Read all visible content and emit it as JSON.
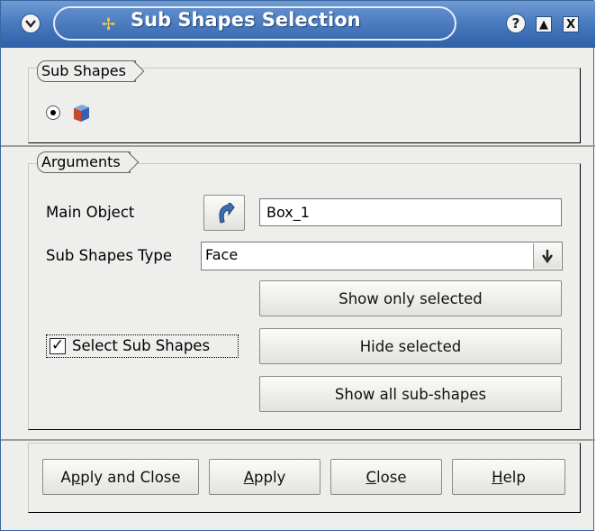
{
  "window": {
    "title": "Sub Shapes Selection",
    "title_color": "#ffffff",
    "titlebar_color": "#4a7cc0",
    "menu_icon": "chevron-down-icon",
    "logo_icon": "salome-logo-icon",
    "help_icon": "help-icon",
    "help_glyph": "?",
    "maximize_icon": "maximize-icon",
    "maximize_glyph": "▲",
    "close_icon": "close-icon",
    "close_glyph": "X"
  },
  "sub_shapes": {
    "label": "Sub Shapes",
    "option_icon": "cube-icon",
    "option_selected": true
  },
  "arguments": {
    "label": "Arguments",
    "main_object_label": "Main Object",
    "main_object_value": "Box_1",
    "select_arrow_icon": "selection-arrow-icon",
    "sub_shapes_type_label": "Sub Shapes Type",
    "sub_shapes_type_value": "Face",
    "dropdown_icon": "arrow-down-icon",
    "dropdown_glyph": "🡓",
    "select_sub_shapes_label": "Select Sub Shapes",
    "select_sub_shapes_checked": true,
    "check_glyph": "✓",
    "show_only_selected": "Show only selected",
    "hide_selected": "Hide selected",
    "show_all_sub_shapes": "Show all sub-shapes"
  },
  "buttons": {
    "apply_and_close_pre": "A",
    "apply_and_close_ul": "p",
    "apply_and_close_post": "ply and Close",
    "apply_ul": "A",
    "apply_post": "pply",
    "close_ul": "C",
    "close_post": "lose",
    "help_ul": "H",
    "help_post": "elp"
  }
}
